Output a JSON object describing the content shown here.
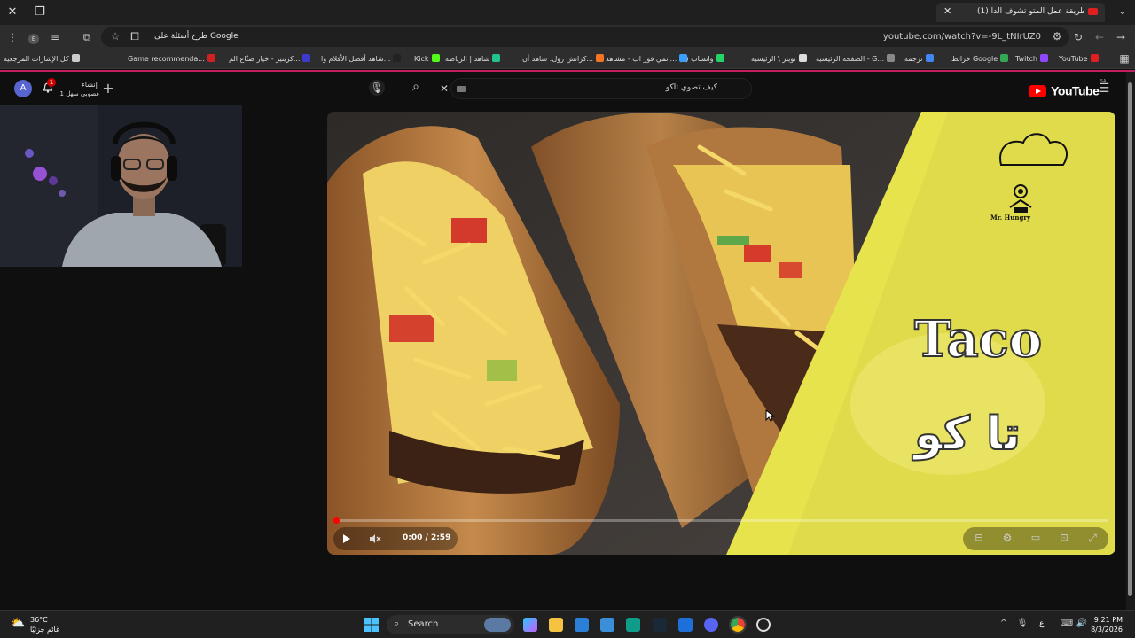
{
  "browser": {
    "tab_title": "(1) طريقة عمل المتو تشوف الدا...",
    "url": "youtube.com/watch?v=-9L_tNIrUZ0",
    "ask_google": "طرح أسئلة على Google"
  },
  "bookmarks": [
    {
      "label": "YouTube",
      "color": "#e02020"
    },
    {
      "label": "Twitch",
      "color": "#9146ff"
    },
    {
      "label": "خرائط Google",
      "color": "#34a853"
    },
    {
      "label": "ترجمة",
      "color": "#4285f4"
    },
    {
      "label": "الصفحة الرئيسية - G...",
      "color": "#888888"
    },
    {
      "label": "تويتر \\ الرئيسية",
      "color": "#dddddd"
    },
    {
      "label": "(٣) واتساب",
      "color": "#25d366"
    },
    {
      "label": "انمي فور اب - مشاهد...",
      "color": "#3aa0ff"
    },
    {
      "label": "كرانش رول: شاهد أن...",
      "color": "#f47521"
    },
    {
      "label": "شاهد | الرياضة",
      "color": "#23c48e"
    },
    {
      "label": "Kick",
      "color": "#53fc18"
    },
    {
      "label": "شاهد أفضل الأفلام وا...",
      "color": "#222222"
    },
    {
      "label": "كريتيز - خيار صنّاع الم...",
      "color": "#3b3bd0"
    },
    {
      "label": "Game recommenda...",
      "color": "#cc2222"
    },
    {
      "label": "كل الإشارات المرجعية",
      "color": "#cccccc"
    }
  ],
  "youtube": {
    "logo_text": "YouTube",
    "region": "SA",
    "search_value": "كيف تصوي تاكو",
    "create_label": "إنشاء",
    "notif_count": "1",
    "channel_handle": "_1 عصوبي سهل",
    "avatar_letter": "A"
  },
  "video": {
    "title_en": "Taco",
    "title_ar": "تا كو",
    "brand": "Mr. Hungry",
    "time_current": "0:00",
    "time_total": "2:59",
    "time_display": "0:00 / 2:59",
    "progress_fraction": 0.004
  },
  "taskbar": {
    "temperature": "36°C",
    "weather_desc": "غائم جزئيًا",
    "search_label": "Search",
    "time": "9:21 PM",
    "date": "8/3/2026",
    "lang": "ع"
  }
}
